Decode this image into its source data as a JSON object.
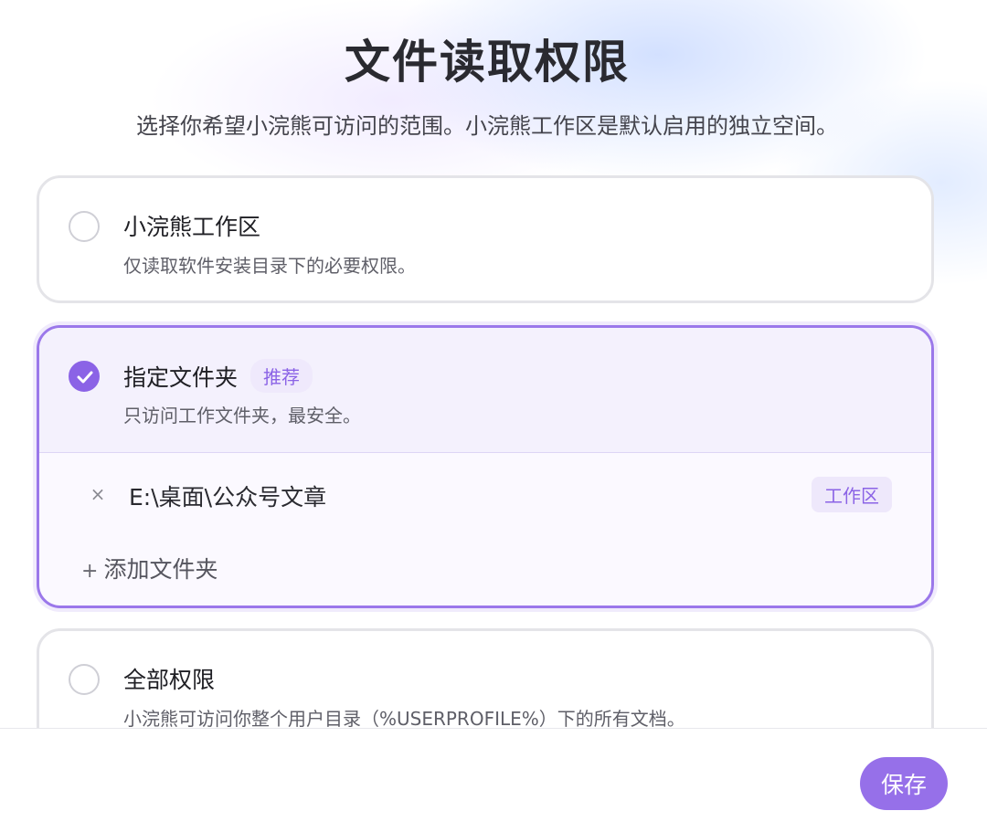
{
  "header": {
    "title": "文件读取权限",
    "subtitle": "选择你希望小浣熊可访问的范围。小浣熊工作区是默认启用的独立空间。"
  },
  "options": [
    {
      "title": "小浣熊工作区",
      "description": "仅读取软件安装目录下的必要权限。",
      "selected": false
    },
    {
      "title": "指定文件夹",
      "badge": "推荐",
      "description": "只访问工作文件夹，最安全。",
      "selected": true,
      "folders": [
        {
          "path": "E:\\桌面\\公众号文章",
          "tag": "工作区",
          "remove_icon": "×"
        }
      ],
      "add_folder_label": "添加文件夹",
      "add_folder_icon": "+"
    },
    {
      "title": "全部权限",
      "description": "小浣熊可访问你整个用户目录（%USERPROFILE%）下的所有文档。",
      "selected": false
    }
  ],
  "footer": {
    "save_label": "保存"
  },
  "colors": {
    "accent": "#8b63e6",
    "accent_light": "#efe9fc",
    "border": "#e4e4e8"
  }
}
